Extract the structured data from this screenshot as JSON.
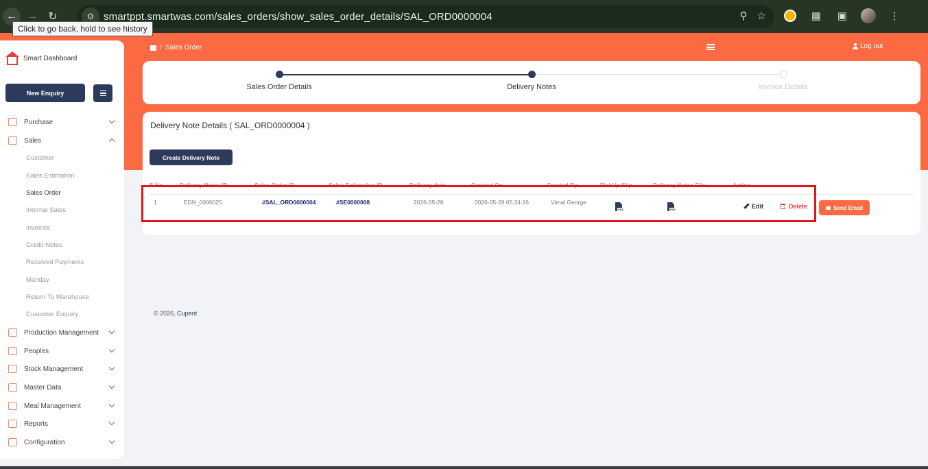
{
  "browser": {
    "url": "smartppt.smartwas.com/sales_orders/show_sales_order_details/SAL_ORD0000004",
    "tooltip": "Click to go back, hold to see history"
  },
  "header": {
    "breadcrumb": "Sales Order",
    "logout_label": "Log out"
  },
  "sidebar": {
    "brand": "Smart Dashboard",
    "new_enquiry_label": "New Enquiry",
    "sections": [
      {
        "label": "Purchase",
        "icon": "cart-icon"
      },
      {
        "label": "Sales",
        "icon": "sales-icon"
      },
      {
        "label": "Production Management",
        "icon": "factory-icon"
      },
      {
        "label": "Peoples",
        "icon": "people-icon"
      },
      {
        "label": "Stock Management",
        "icon": "stock-icon"
      },
      {
        "label": "Master Data",
        "icon": "database-icon"
      },
      {
        "label": "Meal Management",
        "icon": "meal-icon"
      },
      {
        "label": "Reports",
        "icon": "reports-icon"
      },
      {
        "label": "Configuration",
        "icon": "config-icon"
      }
    ],
    "sales_sub": [
      "Customer",
      "Sales Estimation",
      "Sales Order",
      "Internal Sales",
      "Invoices",
      "Credit Notes",
      "Received Payments",
      "Manday",
      "Return To Warehouse",
      "Customer Enquiry"
    ],
    "active_sub": "Sales Order"
  },
  "stepper": {
    "steps": [
      {
        "label": "Sales Order Details",
        "state": "done"
      },
      {
        "label": "Delivery Notes",
        "state": "current"
      },
      {
        "label": "Invoice Details",
        "state": "todo"
      }
    ]
  },
  "details": {
    "title": "Delivery Note Details ( SAL_ORD0000004 )",
    "create_label": "Create Delivery Note",
    "columns": [
      "S.No",
      "Delivery Notes ID",
      "Sales Order ID",
      "Sales Estimation ID",
      "Delivery date",
      "Created On",
      "Created By",
      "PickUp Slip",
      "Delivery Notes File",
      "Action"
    ],
    "rows": [
      {
        "sno": "1",
        "delivery_note_id": "EDN_0000025",
        "sales_order_id": "#SAL_ORD0000004",
        "sales_estimation_id": "#SE0000008",
        "delivery_date": "2026-05-28",
        "created_on": "2026-05-28 05:34:16",
        "created_by": "Vimal George",
        "file_tag": "PDF"
      }
    ],
    "edit_label": "Edit",
    "delete_label": "Delete",
    "email_label": "Send Email"
  },
  "footer": {
    "copyright": "© 2026,",
    "company": "Cupent"
  },
  "colors": {
    "brand_orange": "#fb6a43",
    "navy": "#2e3a5c",
    "danger": "#e0413b",
    "highlight": "#e2151b"
  }
}
